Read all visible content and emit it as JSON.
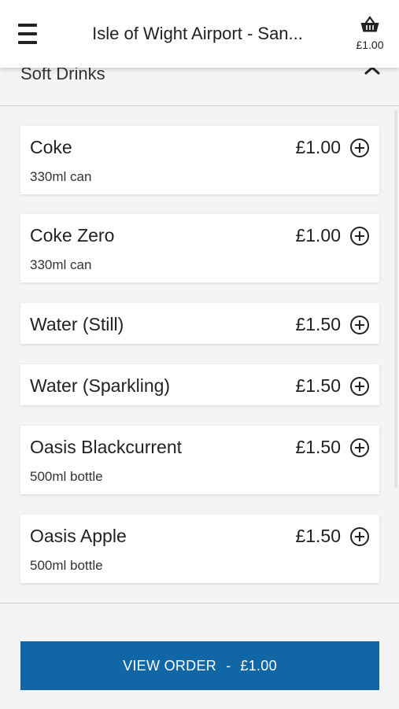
{
  "header": {
    "title": "Isle of Wight Airport - San...",
    "basket_total": "£1.00"
  },
  "section": {
    "title": "Soft Drinks"
  },
  "items": [
    {
      "name": "Coke",
      "description": "330ml can",
      "price": "£1.00"
    },
    {
      "name": "Coke Zero",
      "description": "330ml can",
      "price": "£1.00"
    },
    {
      "name": "Water (Still)",
      "description": "",
      "price": "£1.50"
    },
    {
      "name": "Water (Sparkling)",
      "description": "",
      "price": "£1.50"
    },
    {
      "name": "Oasis Blackcurrent",
      "description": "500ml bottle",
      "price": "£1.50"
    },
    {
      "name": "Oasis Apple",
      "description": "500ml bottle",
      "price": "£1.50"
    }
  ],
  "footer": {
    "view_order_label": "VIEW ORDER",
    "separator": "-",
    "order_total": "£1.00"
  },
  "colors": {
    "primary": "#1166a6",
    "background": "#f4f4f4",
    "card": "#ffffff"
  },
  "icons": {
    "menu": "hamburger-menu-icon",
    "basket": "basket-icon",
    "collapse": "chevron-up-icon",
    "add": "plus-circle-icon"
  }
}
